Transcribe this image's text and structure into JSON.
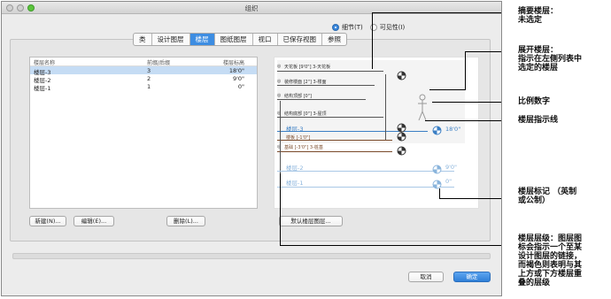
{
  "window": {
    "title": "组织"
  },
  "view_options": {
    "detail_label": "细节(T)",
    "visibility_label": "可见性(I)",
    "selected": "detail"
  },
  "tabs": [
    {
      "label": "类",
      "active": false
    },
    {
      "label": "设计图层",
      "active": false
    },
    {
      "label": "楼层",
      "active": true
    },
    {
      "label": "图纸图层",
      "active": false
    },
    {
      "label": "视口",
      "active": false
    },
    {
      "label": "已保存视图",
      "active": false
    },
    {
      "label": "参照",
      "active": false
    }
  ],
  "story_list": {
    "columns": [
      "楼层名称",
      "前缀/后缀",
      "楼层标高"
    ],
    "rows": [
      {
        "name": "楼层-3",
        "prefix": "3",
        "elevation": "18'0\"",
        "selected": true
      },
      {
        "name": "楼层-2",
        "prefix": "2",
        "elevation": "9'0\"",
        "selected": false
      },
      {
        "name": "楼层-1",
        "prefix": "1",
        "elevation": "0\"",
        "selected": false
      }
    ]
  },
  "buttons": {
    "new": "新建(N)...",
    "edit": "编辑(E)...",
    "delete": "删除(L)...",
    "default_levels": "默认楼层图层...",
    "cancel": "取消",
    "ok": "确定"
  },
  "preview": {
    "levels": [
      {
        "label": "天花板 [9'0\"] 3-天花板",
        "color": "brown"
      },
      {
        "label": "装修楼面 [2\"] 3-楼面",
        "color": "brown"
      },
      {
        "label": "结构顶部 [0\"]",
        "color": "brown"
      },
      {
        "label": "结构底部 [0\"] 3-屋顶",
        "color": "brown"
      },
      {
        "label": "楼板 [-1'0\"]",
        "color": "brown"
      },
      {
        "label": "基础 [-3'0\"] 3-桩基",
        "color": "brown"
      }
    ],
    "stories": [
      {
        "label": "楼层-3",
        "elevation": "18'0\"",
        "current": true
      },
      {
        "label": "楼层-2",
        "elevation": "9'0\"",
        "current": false
      },
      {
        "label": "楼层-1",
        "elevation": "0\"",
        "current": false
      }
    ]
  },
  "callouts": [
    {
      "id": "summary",
      "lines": [
        "摘要楼层：",
        "未选定"
      ]
    },
    {
      "id": "expand",
      "lines": [
        "展开楼层：",
        "指示在左侧列表中",
        "选定的楼层"
      ]
    },
    {
      "id": "scale",
      "lines": [
        "比例数字"
      ]
    },
    {
      "id": "indicator",
      "lines": [
        "楼层指示线"
      ]
    },
    {
      "id": "marker",
      "lines": [
        "楼层标记 （英制",
        "或公制）"
      ]
    },
    {
      "id": "levels",
      "lines": [
        "楼层层级：图层图",
        "标会指示一个至某",
        "设计图层的链接，",
        "而褐色则表明与其",
        "上方或下方楼层重",
        "叠的层级"
      ]
    }
  ],
  "colors": {
    "accent": "#3d8de2",
    "brown": "#7a4a2a",
    "story_blue": "#3b7fc4"
  }
}
